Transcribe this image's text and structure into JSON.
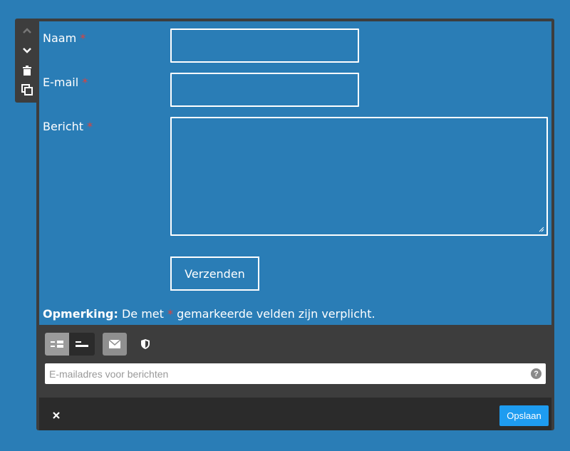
{
  "toolbar": {
    "icons": [
      "chevron-up-icon",
      "chevron-down-icon",
      "trash-icon",
      "duplicate-icon"
    ]
  },
  "form": {
    "fields": [
      {
        "label": "Naam",
        "required": "*"
      },
      {
        "label": "E-mail",
        "required": "*"
      },
      {
        "label": "Bericht",
        "required": "*"
      }
    ],
    "submit_label": "Verzenden",
    "note_bold": "Opmerking:",
    "note_pre": "De met",
    "note_star": "*",
    "note_post": "gemarkeerde velden zijn verplicht."
  },
  "settings": {
    "email_placeholder": "E-mailadres voor berichten",
    "help": "?"
  },
  "footer": {
    "close_label": "✕",
    "save_label": "Opslaan"
  },
  "colors": {
    "background": "#2a7db6",
    "panel_dark": "#3d3d3d",
    "footer": "#2b2b2b",
    "required": "#e0403b",
    "save_button": "#1e9cf0"
  }
}
